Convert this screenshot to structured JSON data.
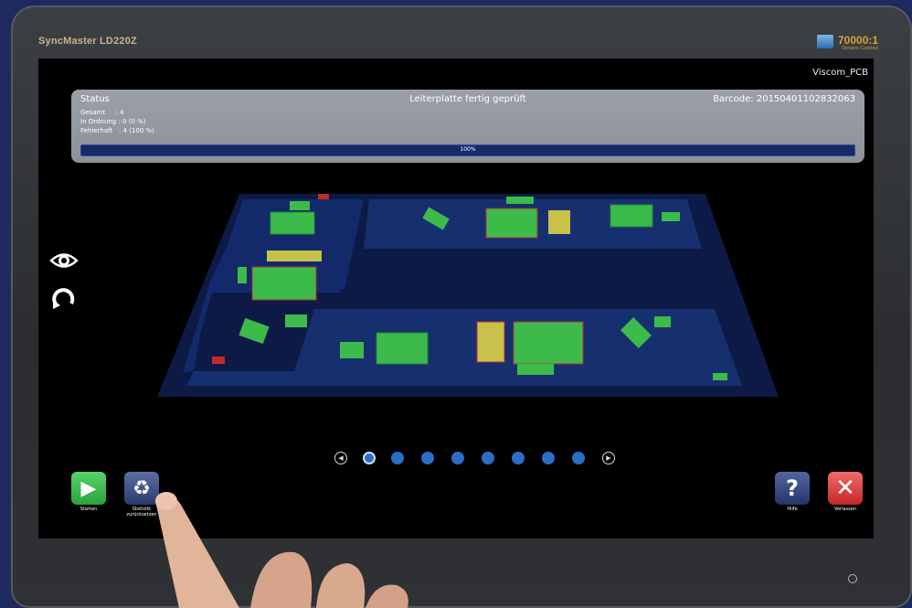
{
  "monitor": {
    "brand": "SyncMaster LD220Z",
    "contrast_label": "70000:1",
    "contrast_sub": "Dynamic Contrast"
  },
  "app": {
    "name": "Viscom_PCB"
  },
  "status": {
    "title": "Status",
    "message": "Leiterplatte fertig geprüft",
    "barcode": "Barcode: 20150401102832063",
    "stats": [
      {
        "label": "Gesamt",
        "sep": ":",
        "value": "4"
      },
      {
        "label": "In Ordnung",
        "sep": ":",
        "value": "0    (0 %)"
      },
      {
        "label": "Fehlerhaft",
        "sep": ":",
        "value": "4  (100 %)"
      }
    ],
    "progress_text": "100%",
    "progress_value": 1.0
  },
  "pager": {
    "page_count": 8,
    "active_index": 0
  },
  "actions": {
    "start_label": "Starten",
    "reset_label": "Statistik zurücksetzen",
    "help_label": "Hilfe",
    "exit_label": "Verlassen"
  },
  "icons": {
    "view": "eye-icon",
    "rotate": "rotate-icon",
    "start": "play-icon",
    "reset": "recycle-icon",
    "help": "question-icon",
    "exit": "close-icon",
    "prev": "chevron-left-icon",
    "next": "chevron-right-icon",
    "power": "power-icon"
  },
  "colors": {
    "accent_blue": "#2a6fc6",
    "status_panel": "#9ba0a8",
    "start_green": "#2aa33c",
    "exit_red": "#c42828",
    "pcb_board": "#0f1c4d",
    "component_green": "#3dbb4a"
  }
}
